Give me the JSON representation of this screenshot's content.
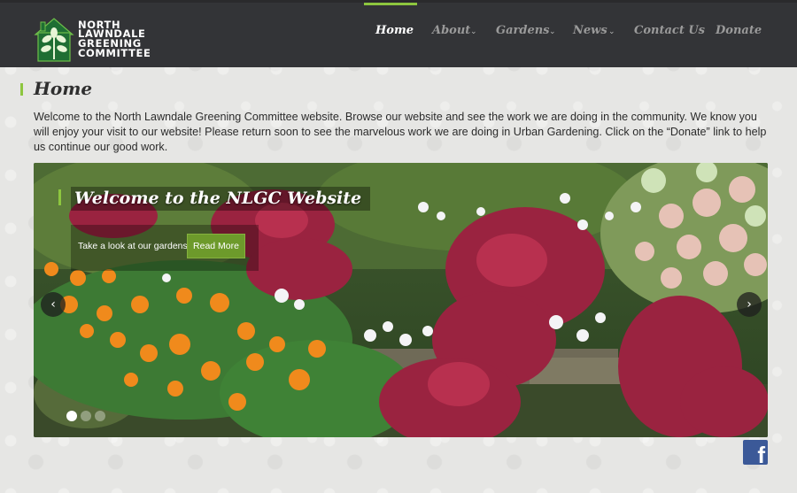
{
  "logo": {
    "line1": "NORTH",
    "line2": "LAWNDALE",
    "line3": "GREENING",
    "line4": "COMMITTEE"
  },
  "nav": {
    "home": "Home",
    "about": "About",
    "gardens": "Gardens",
    "news": "News",
    "contact": "Contact Us",
    "donate": "Donate",
    "caret": "⌄"
  },
  "page": {
    "title": "Home",
    "intro": "Welcome to the North Lawndale Greening Committee website. Browse our website and see the work we are doing in the community. We know you will enjoy your visit to our website! Please return soon to see the marvelous work we are doing in Urban Gardening.  Click on the “Donate” link to help us continue our good work."
  },
  "slider": {
    "caption_title": "Welcome to the NLGC Website",
    "caption_text": "Take a look at our gardens!",
    "button_label": "Read More",
    "prev_glyph": "‹",
    "next_glyph": "›"
  },
  "social": {
    "facebook_glyph": "f"
  },
  "colors": {
    "header_bg": "#333437",
    "accent_green": "#8dc63f",
    "button_green": "#6d9a2b",
    "facebook_blue": "#3b5998"
  }
}
